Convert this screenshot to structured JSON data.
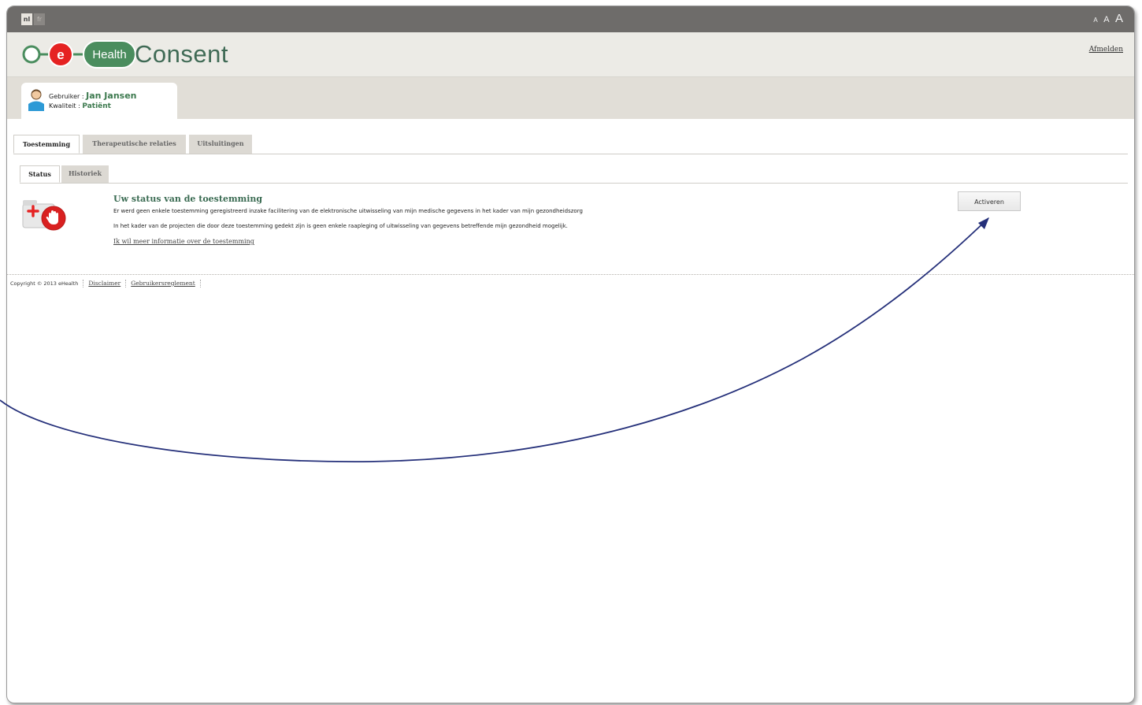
{
  "language": {
    "nl": "nl",
    "fr": "fr"
  },
  "font_size_controls": {
    "small": "A",
    "medium": "A",
    "large": "A"
  },
  "header": {
    "logo_e": "e",
    "logo_health": "Health",
    "title": "Consent",
    "logout_label": "Afmelden"
  },
  "user": {
    "user_label": "Gebruiker : ",
    "user_name": "Jan Jansen",
    "quality_label": "Kwaliteit : ",
    "quality_value": "Patiënt"
  },
  "main_tabs": [
    {
      "label": "Toestemming",
      "active": true
    },
    {
      "label": "Therapeutische relaties",
      "active": false
    },
    {
      "label": "Uitsluitingen",
      "active": false
    }
  ],
  "sub_tabs": [
    {
      "label": "Status",
      "active": true
    },
    {
      "label": "Historiek",
      "active": false
    }
  ],
  "status": {
    "title": "Uw status van de toestemming",
    "line1": "Er werd geen enkele toestemming geregistreerd inzake facilitering van de elektronische uitwisseling van mijn medische gegevens in het kader van mijn gezondheidszorg",
    "line2": "In het kader van de projecten die door deze toestemming gedekt zijn is geen enkele raapleging of uitwisseling van gegevens betreffende mijn gezondheid mogelijk.",
    "info_link": "Ik wil meer informatie over de toestemming",
    "activate_button": "Activeren"
  },
  "footer": {
    "copyright": "Copyright © 2013 eHealth",
    "disclaimer": "Disclaimer",
    "terms": "Gebruikersreglement"
  },
  "colors": {
    "accent_green": "#3d7a4f",
    "logo_red": "#e52222",
    "logo_green": "#4a8d5e",
    "topbar": "#6e6c6a",
    "annotation_arrow": "#25307a"
  }
}
